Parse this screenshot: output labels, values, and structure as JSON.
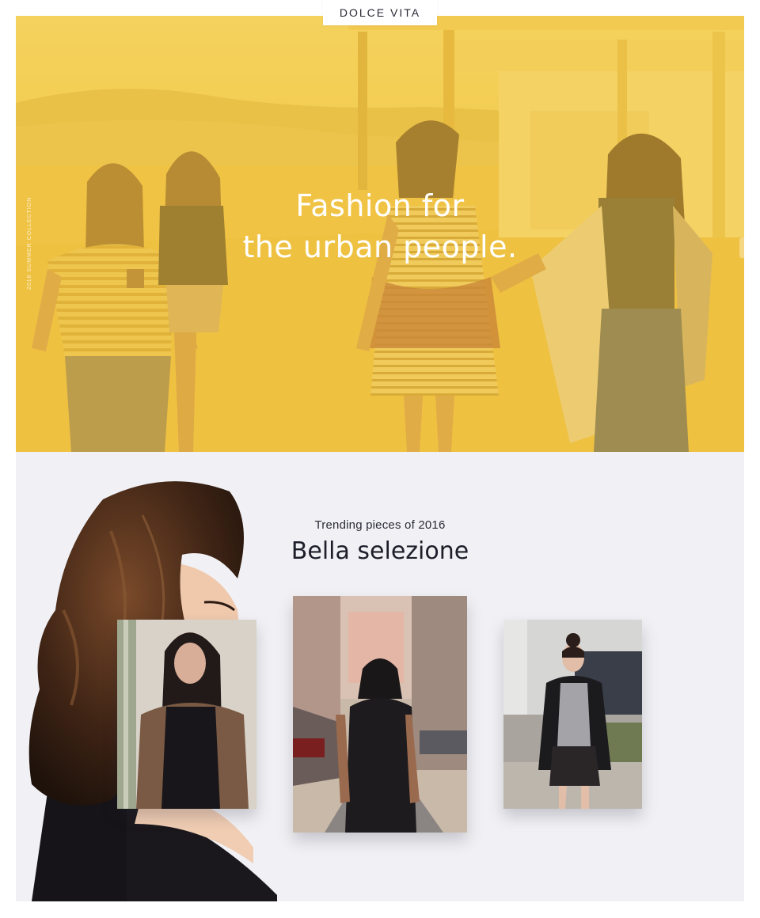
{
  "brand": {
    "logo_text": "DOLCE VITA"
  },
  "hero": {
    "side_text": "2016 Summer Collection",
    "headline_line1": "Fashion for",
    "headline_line2": "the urban people.",
    "overlay_color": "#f2c744"
  },
  "selection": {
    "eyebrow": "Trending pieces of 2016",
    "title": "Bella selezione",
    "background": "#f1f1f5"
  },
  "icons": {
    "next": "chevron-right-icon"
  }
}
